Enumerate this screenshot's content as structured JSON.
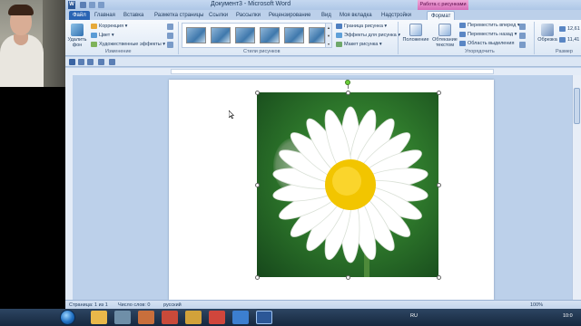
{
  "window": {
    "title": "Документ3 - Microsoft Word"
  },
  "context_tab_group": "Работа с рисунками",
  "tabs": [
    "Файл",
    "Главная",
    "Вставка",
    "Разметка страницы",
    "Ссылки",
    "Рассылки",
    "Рецензирование",
    "Вид",
    "Моя вкладка",
    "Надстройки",
    "Формат"
  ],
  "ribbon": {
    "remove_bg": "Удалить фон",
    "adjust": {
      "correction": "Коррекция",
      "color": "Цвет",
      "artistic": "Художественные эффекты",
      "group": "Изменение"
    },
    "styles_group": "Стили рисунков",
    "picture_options": {
      "border": "Граница рисунка",
      "effects": "Эффекты для рисунка",
      "layout": "Макет рисунка"
    },
    "arrange": {
      "position": "Положение",
      "wrap": "Обтекание текстом",
      "forward": "Переместить вперед",
      "backward": "Переместить назад",
      "selection_pane": "Область выделения",
      "group": "Упорядочить"
    },
    "size": {
      "crop": "Обрезка",
      "height": "12,61",
      "width": "11,41",
      "group": "Размер"
    }
  },
  "statusbar": {
    "page": "Страница: 1 из 1",
    "words": "Число слов: 0",
    "lang": "русский",
    "zoom": "100%"
  },
  "tray": {
    "lang": "RU",
    "time": "10:0"
  },
  "colors": {
    "file_tab": "#2a64b4",
    "context_tab": "#d66cb8",
    "petal": "#ffffff",
    "center": "#f2c500",
    "grass": "#2f7a2c"
  }
}
